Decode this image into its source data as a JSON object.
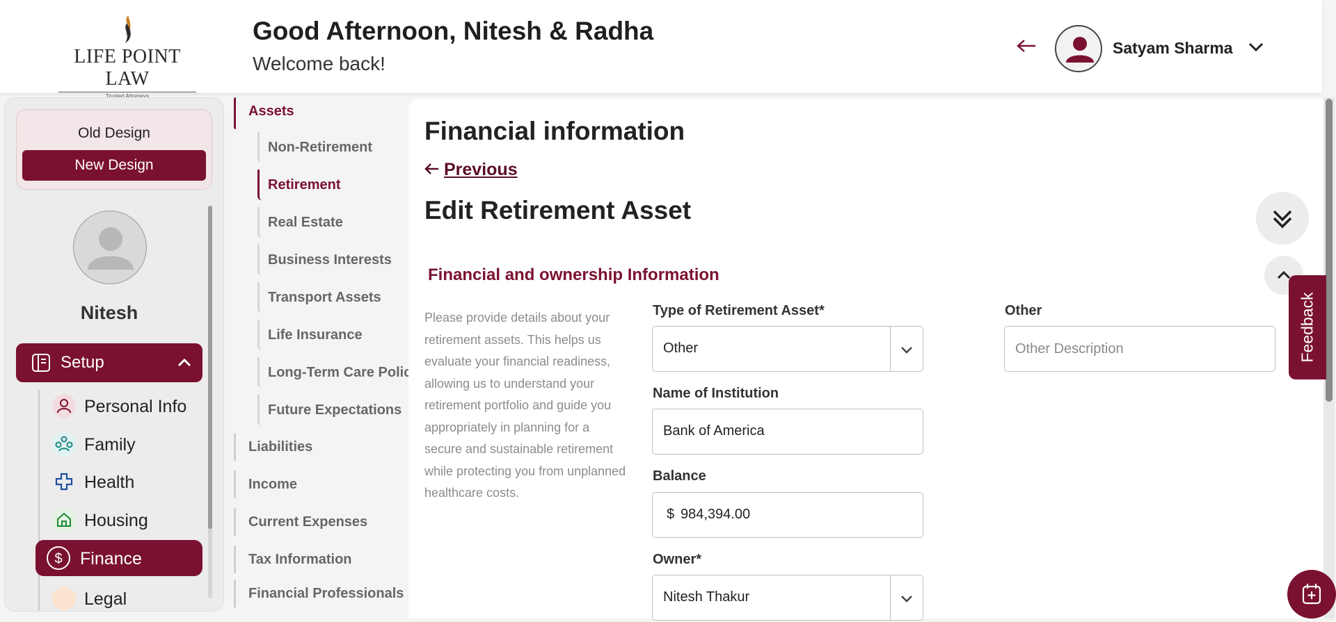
{
  "header": {
    "logo_name": "LIFE POINT LAW",
    "logo_tagline": "Trusted Attorneys",
    "greeting": "Good Afternoon, Nitesh & Radha",
    "welcome": "Welcome back!",
    "user_name": "Satyam Sharma"
  },
  "sidebar": {
    "old_design": "Old Design",
    "new_design": "New Design",
    "profile_name": "Nitesh",
    "setup_label": "Setup",
    "items": [
      {
        "label": "Personal Info",
        "icon": "person-icon"
      },
      {
        "label": "Family",
        "icon": "family-icon"
      },
      {
        "label": "Health",
        "icon": "medical-cross-icon"
      },
      {
        "label": "Housing",
        "icon": "house-icon"
      },
      {
        "label": "Finance",
        "icon": "dollar-icon",
        "active": true
      },
      {
        "label": "Legal",
        "icon": "legal-icon"
      }
    ]
  },
  "subnav": {
    "assets": "Assets",
    "asset_items": [
      "Non-Retirement",
      "Retirement",
      "Real Estate",
      "Business Interests",
      "Transport Assets",
      "Life Insurance",
      "Long-Term Care Policy",
      "Future Expectations"
    ],
    "groups": [
      "Liabilities",
      "Income",
      "Current Expenses",
      "Tax Information",
      "Financial Professionals"
    ]
  },
  "main": {
    "page_title": "Financial information",
    "previous": "Previous",
    "edit_title": "Edit Retirement Asset",
    "section_title": "Financial and ownership Information",
    "description": "Please provide details about your retirement assets. This helps us evaluate your financial readiness, allowing us to understand your retirement portfolio and guide you appropriately in planning for a secure and sustainable retirement while protecting you from unplanned healthcare costs.",
    "type_label": "Type of Retirement Asset*",
    "type_value": "Other",
    "other_label": "Other",
    "other_placeholder": "Other Description",
    "institution_label": "Name of Institution",
    "institution_value": "Bank of America",
    "balance_label": "Balance",
    "balance_currency": "$",
    "balance_value": "984,394.00",
    "owner_label": "Owner*",
    "owner_value": "Nitesh Thakur"
  },
  "feedback": "Feedback",
  "colors": {
    "brand": "#7a1130",
    "brand_light": "#f3e6e8"
  }
}
